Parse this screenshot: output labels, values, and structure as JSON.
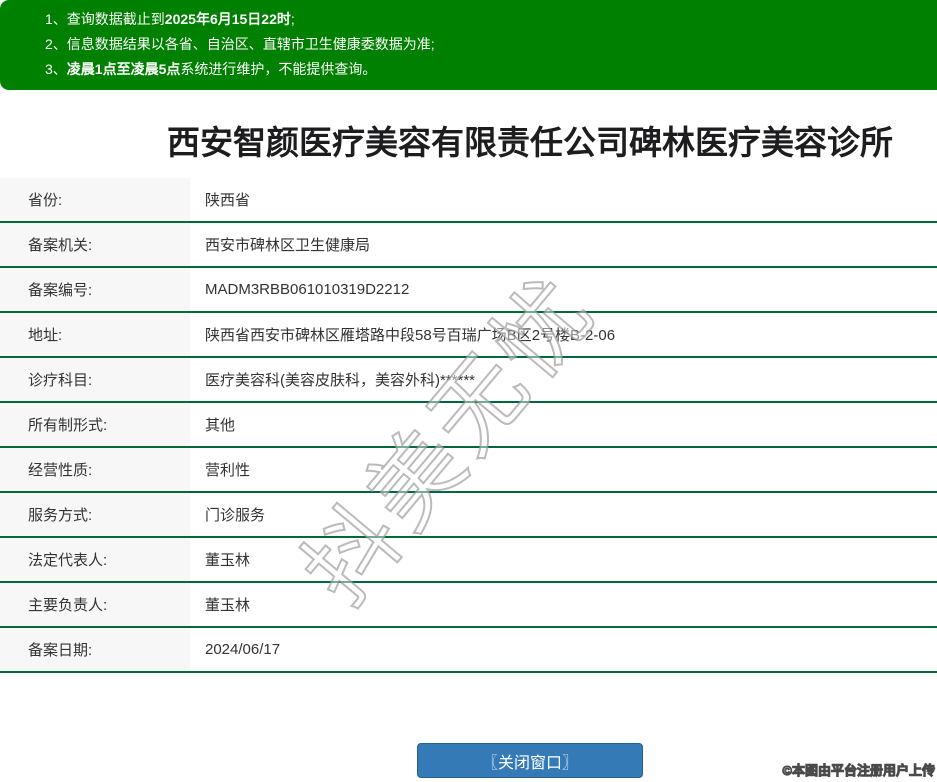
{
  "notice": {
    "lines": [
      {
        "pre": "1、查询数据截止到",
        "bold": "2025年6月15日22时",
        "post": ";"
      },
      {
        "pre": "2、信息数据结果以各省、自治区、直辖市卫生健康委数据为准;",
        "bold": "",
        "post": ""
      },
      {
        "pre": "3、",
        "bold": "凌晨1点至凌晨5点",
        "post": "系统进行维护，不能提供查询。"
      }
    ]
  },
  "title": "西安智颜医疗美容有限责任公司碑林医疗美容诊所",
  "table": {
    "rows": [
      {
        "label": "省份:",
        "value": "陕西省"
      },
      {
        "label": "备案机关:",
        "value": "西安市碑林区卫生健康局"
      },
      {
        "label": "备案编号:",
        "value": "MADM3RBB061010319D2212"
      },
      {
        "label": "地址:",
        "value": "陕西省西安市碑林区雁塔路中段58号百瑞广场B区2号楼B-2-06"
      },
      {
        "label": "诊疗科目:",
        "value": "医疗美容科(美容皮肤科，美容外科)******"
      },
      {
        "label": "所有制形式:",
        "value": "其他"
      },
      {
        "label": "经营性质:",
        "value": "营利性"
      },
      {
        "label": "服务方式:",
        "value": "门诊服务"
      },
      {
        "label": "法定代表人:",
        "value": "董玉林"
      },
      {
        "label": "主要负责人:",
        "value": "董玉林"
      },
      {
        "label": "备案日期:",
        "value": "2024/06/17"
      }
    ]
  },
  "button": {
    "close_label": "〖关闭窗口〗"
  },
  "watermark": {
    "text": "抖美无忧"
  },
  "footer": {
    "credit": "©本图由平台注册用户上传"
  },
  "colors": {
    "banner_green": "#008000",
    "row_border_green": "#00693a",
    "label_bg": "#f7f7f7",
    "button_blue": "#337ab7",
    "text": "#333333"
  }
}
